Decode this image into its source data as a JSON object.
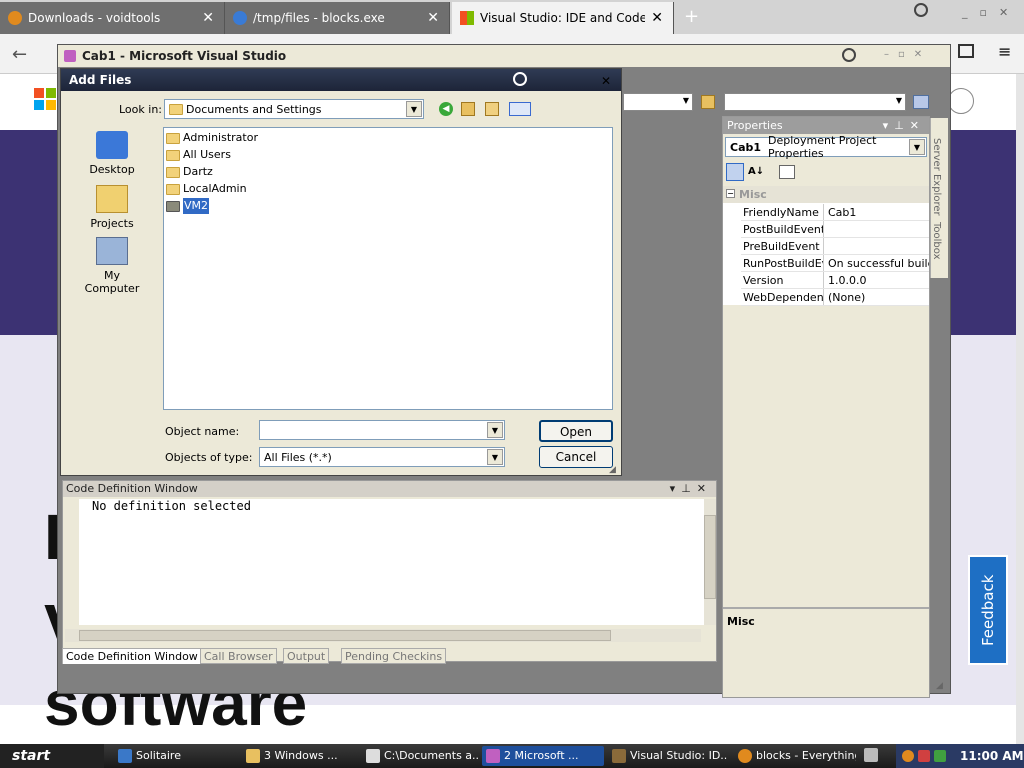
{
  "browser": {
    "tabs": [
      {
        "title": "Downloads - voidtools",
        "active": false
      },
      {
        "title": "/tmp/files - blocks.exe",
        "active": false
      },
      {
        "title": "Visual Studio: IDE and Code Editor",
        "active": true
      }
    ],
    "new_tab": "+"
  },
  "webpage": {
    "line1": "I",
    "line2": "V",
    "line3": "software",
    "feedback": "Feedback"
  },
  "vs": {
    "title": "Cab1 - Microsoft Visual Studio"
  },
  "dialog": {
    "title": "Add Files",
    "look_in_label": "Look in:",
    "look_in_value": "Documents and Settings",
    "places": [
      "Desktop",
      "Projects",
      "My Computer"
    ],
    "files": [
      "Administrator",
      "All Users",
      "Dartz",
      "LocalAdmin",
      "VM2"
    ],
    "selected_file": "VM2",
    "object_name_label": "Object name:",
    "object_name_value": "",
    "type_label": "Objects of type:",
    "type_value": "All Files (*.*)",
    "open_button": "Open",
    "cancel_button": "Cancel"
  },
  "properties": {
    "title": "Properties",
    "object": "Cab1",
    "object_type": "Deployment Project Properties",
    "category": "Misc",
    "rows": [
      {
        "k": "FriendlyName",
        "v": "Cab1"
      },
      {
        "k": "PostBuildEvent",
        "v": ""
      },
      {
        "k": "PreBuildEvent",
        "v": ""
      },
      {
        "k": "RunPostBuildEve",
        "v": "On successful build"
      },
      {
        "k": "Version",
        "v": "1.0.0.0"
      },
      {
        "k": "WebDependenci",
        "v": "(None)"
      }
    ],
    "desc_title": "Misc",
    "side_tabs": [
      "Server Explorer",
      "Toolbox"
    ]
  },
  "code_def": {
    "title": "Code Definition Window",
    "text": "No definition selected",
    "tabs": [
      "Code Definition Window",
      "Call Browser",
      "Output",
      "Pending Checkins"
    ]
  },
  "taskbar": {
    "start": "start",
    "items": [
      "Solitaire",
      "3 Windows ...",
      "C:\\Documents a...",
      "2 Microsoft ...",
      "Visual Studio: ID...",
      "blocks - Everything"
    ],
    "clock": "11:00 AM"
  },
  "colors": {
    "accent": "#3c3273",
    "feedback": "#1e6fc4",
    "selection": "#316ac5"
  }
}
